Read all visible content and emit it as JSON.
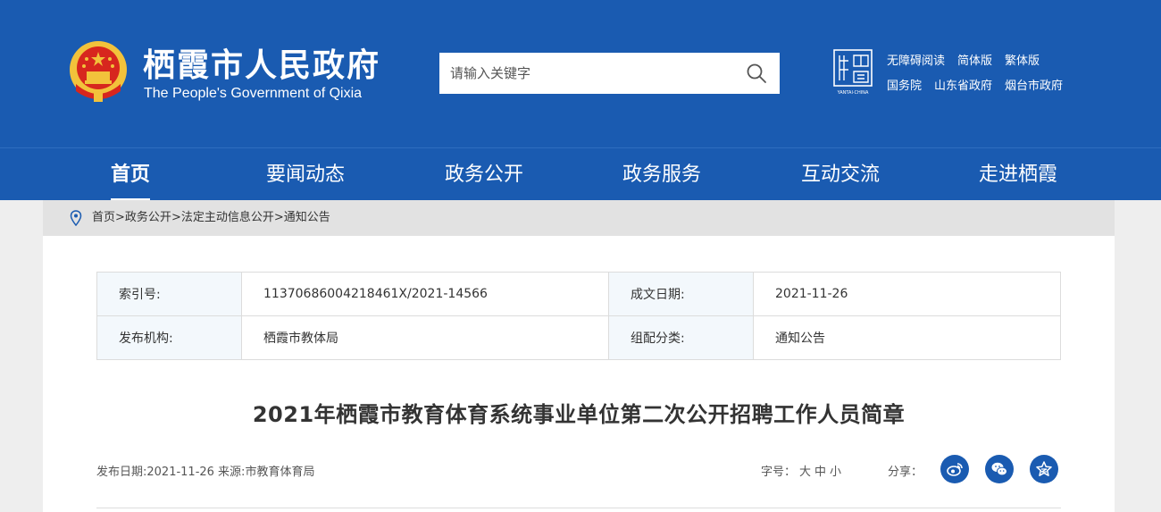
{
  "header": {
    "site_name_cn": "栖霞市人民政府",
    "site_name_en": "The People's Government of Qixia",
    "search_placeholder": "请输入关键字",
    "seal_caption": "YANTAI·CHINA",
    "links_row1": [
      "无障碍阅读",
      "简体版",
      "繁体版"
    ],
    "links_row2": [
      "国务院",
      "山东省政府",
      "烟台市政府"
    ]
  },
  "nav": {
    "items": [
      "首页",
      "要闻动态",
      "政务公开",
      "政务服务",
      "互动交流",
      "走进栖霞"
    ],
    "active_index": 0
  },
  "breadcrumb": [
    "首页",
    "政务公开",
    "法定主动信息公开",
    "通知公告"
  ],
  "meta": {
    "rows": [
      {
        "k1": "索引号:",
        "v1": "11370686004218461X/2021-14566",
        "k2": "成文日期:",
        "v2": "2021-11-26"
      },
      {
        "k1": "发布机构:",
        "v1": "栖霞市教体局",
        "k2": "组配分类:",
        "v2": "通知公告"
      }
    ]
  },
  "article": {
    "title": "2021年栖霞市教育体育系统事业单位第二次公开招聘工作人员简章",
    "info": "发布日期:2021-11-26 来源:市教育体育局",
    "fontsize_label": "字号：",
    "fontsize_options": [
      "大",
      "中",
      "小"
    ],
    "share_label": "分享："
  },
  "colors": {
    "brand_blue": "#1a5bb1",
    "meta_key_bg": "#f3f8fc"
  },
  "icons": [
    "emblem-icon",
    "search-icon",
    "seal-icon",
    "location-pin-icon",
    "weibo-icon",
    "wechat-icon",
    "qzone-icon"
  ]
}
